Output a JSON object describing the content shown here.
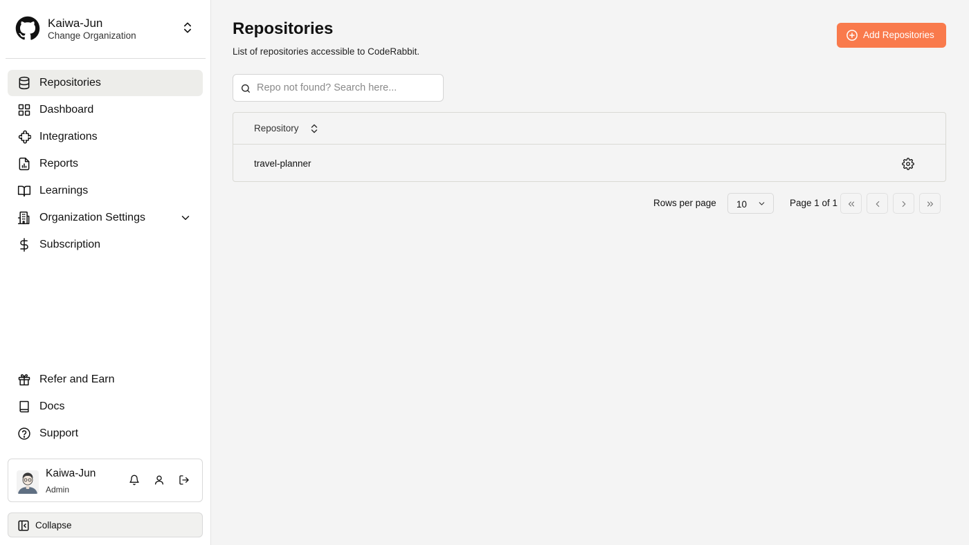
{
  "org": {
    "name": "Kaiwa-Jun",
    "subtitle": "Change Organization"
  },
  "nav": {
    "items": [
      {
        "label": "Repositories",
        "icon": "database-icon",
        "active": true
      },
      {
        "label": "Dashboard",
        "icon": "grid-icon"
      },
      {
        "label": "Integrations",
        "icon": "puzzle-icon"
      },
      {
        "label": "Reports",
        "icon": "report-icon"
      },
      {
        "label": "Learnings",
        "icon": "book-open-icon"
      },
      {
        "label": "Organization Settings",
        "icon": "building-icon"
      },
      {
        "label": "Subscription",
        "icon": "dollar-icon"
      }
    ],
    "bottom": [
      {
        "label": "Refer and Earn",
        "icon": "gift-icon"
      },
      {
        "label": "Docs",
        "icon": "book-icon"
      },
      {
        "label": "Support",
        "icon": "help-circle-icon"
      }
    ]
  },
  "user": {
    "name": "Kaiwa-Jun",
    "role": "Admin"
  },
  "collapse_label": "Collapse",
  "page": {
    "title": "Repositories",
    "subtitle": "List of repositories accessible to CodeRabbit.",
    "add_button": "Add Repositories",
    "search_placeholder": "Repo not found? Search here..."
  },
  "table": {
    "column": "Repository",
    "rows": [
      "travel-planner"
    ]
  },
  "pagination": {
    "rows_per_page_label": "Rows per page",
    "rows_per_page": "10",
    "page_info": "Page 1 of 1"
  },
  "colors": {
    "accent": "#f97a4c",
    "active_nav": "#ededea",
    "background": "#f4f4f4"
  }
}
